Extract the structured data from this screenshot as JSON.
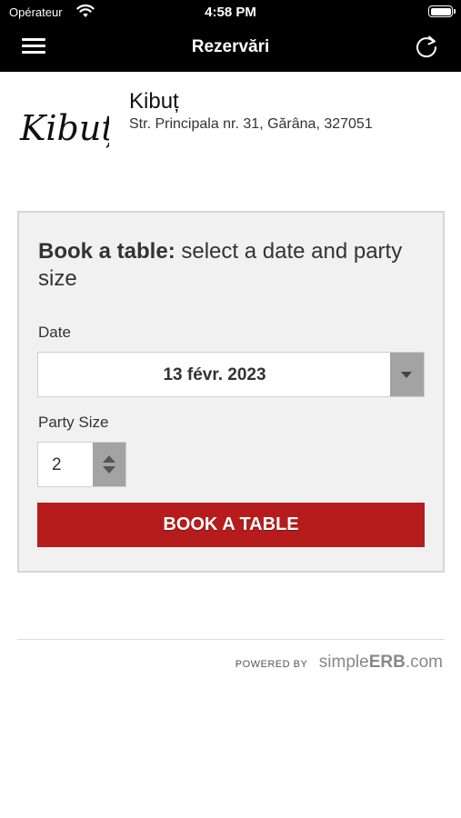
{
  "status_bar": {
    "carrier": "Opérateur",
    "time": "4:58 PM"
  },
  "nav": {
    "title": "Rezervări"
  },
  "restaurant": {
    "logo_text": "Kibuț",
    "name": "Kibuț",
    "address": "Str. Principala nr. 31, Gărâna, 327051"
  },
  "booking": {
    "title_bold": "Book a table:",
    "title_rest": " select a date and party size",
    "date_label": "Date",
    "date_value": "13 févr. 2023",
    "party_label": "Party Size",
    "party_value": "2",
    "button_label": "BOOK A TABLE"
  },
  "footer": {
    "powered_by": "POWERED BY",
    "brand_simple": "simple",
    "brand_erb": "ERB",
    "brand_domain": ".com"
  },
  "colors": {
    "top_bar": "#000000",
    "button": "#b71c1c",
    "panel": "#f1f1f1"
  }
}
